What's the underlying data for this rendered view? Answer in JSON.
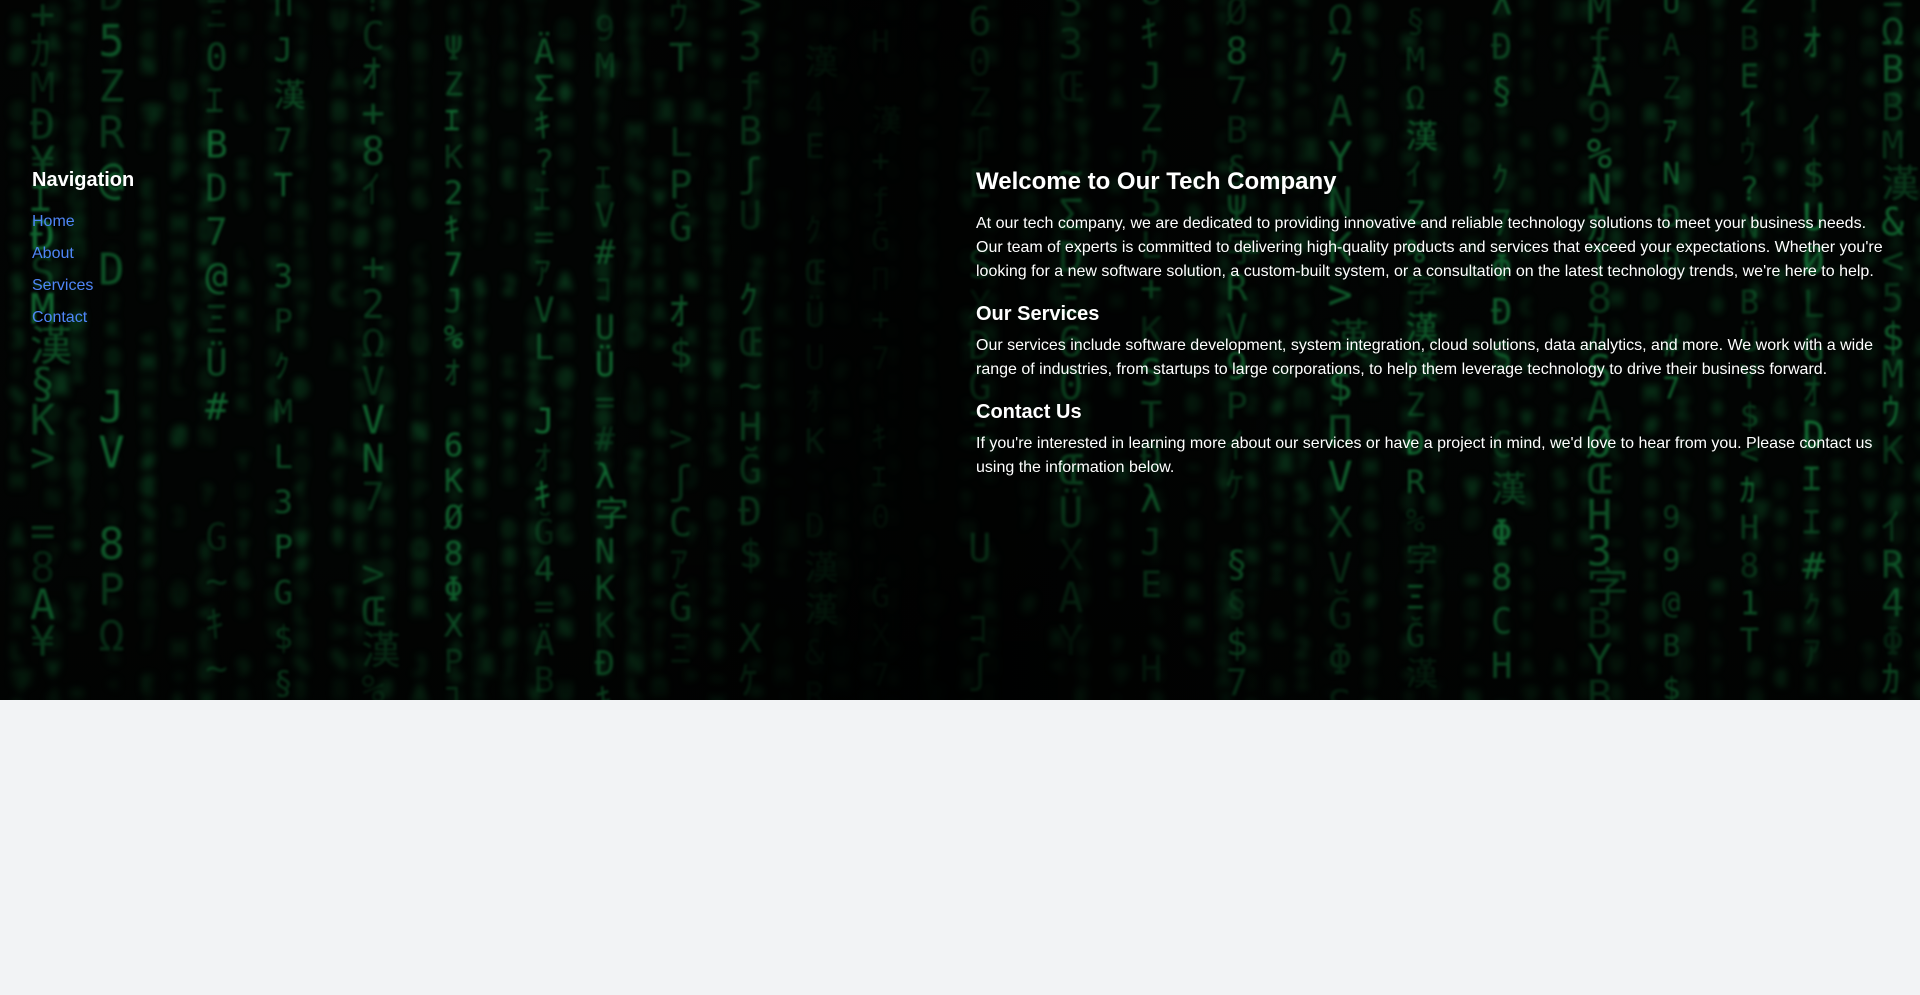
{
  "sidebar": {
    "heading": "Navigation",
    "links": [
      {
        "label": "Home"
      },
      {
        "label": "About"
      },
      {
        "label": "Services"
      },
      {
        "label": "Contact"
      }
    ]
  },
  "main": {
    "title": "Welcome to Our Tech Company",
    "intro": "At our tech company, we are dedicated to providing innovative and reliable technology solutions to meet your business needs. Our team of experts is committed to delivering high-quality products and services that exceed your expectations. Whether you're looking for a new software solution, a custom-built system, or a consultation on the latest technology trends, we're here to help.",
    "services_heading": "Our Services",
    "services_text": "Our services include software development, system integration, cloud solutions, data analytics, and more. We work with a wide range of industries, from startups to large corporations, to help them leverage technology to drive their business forward.",
    "contact_heading": "Contact Us",
    "contact_text": "If you're interested in learning more about our services or have a project in mind, we'd love to hear from you. Please contact us using the information below."
  },
  "colors": {
    "hero_background": "#020403",
    "matrix_green": "#1fbf5a",
    "link": "#4f86f7",
    "page_background": "#f2f3f5",
    "text": "#ffffff"
  }
}
